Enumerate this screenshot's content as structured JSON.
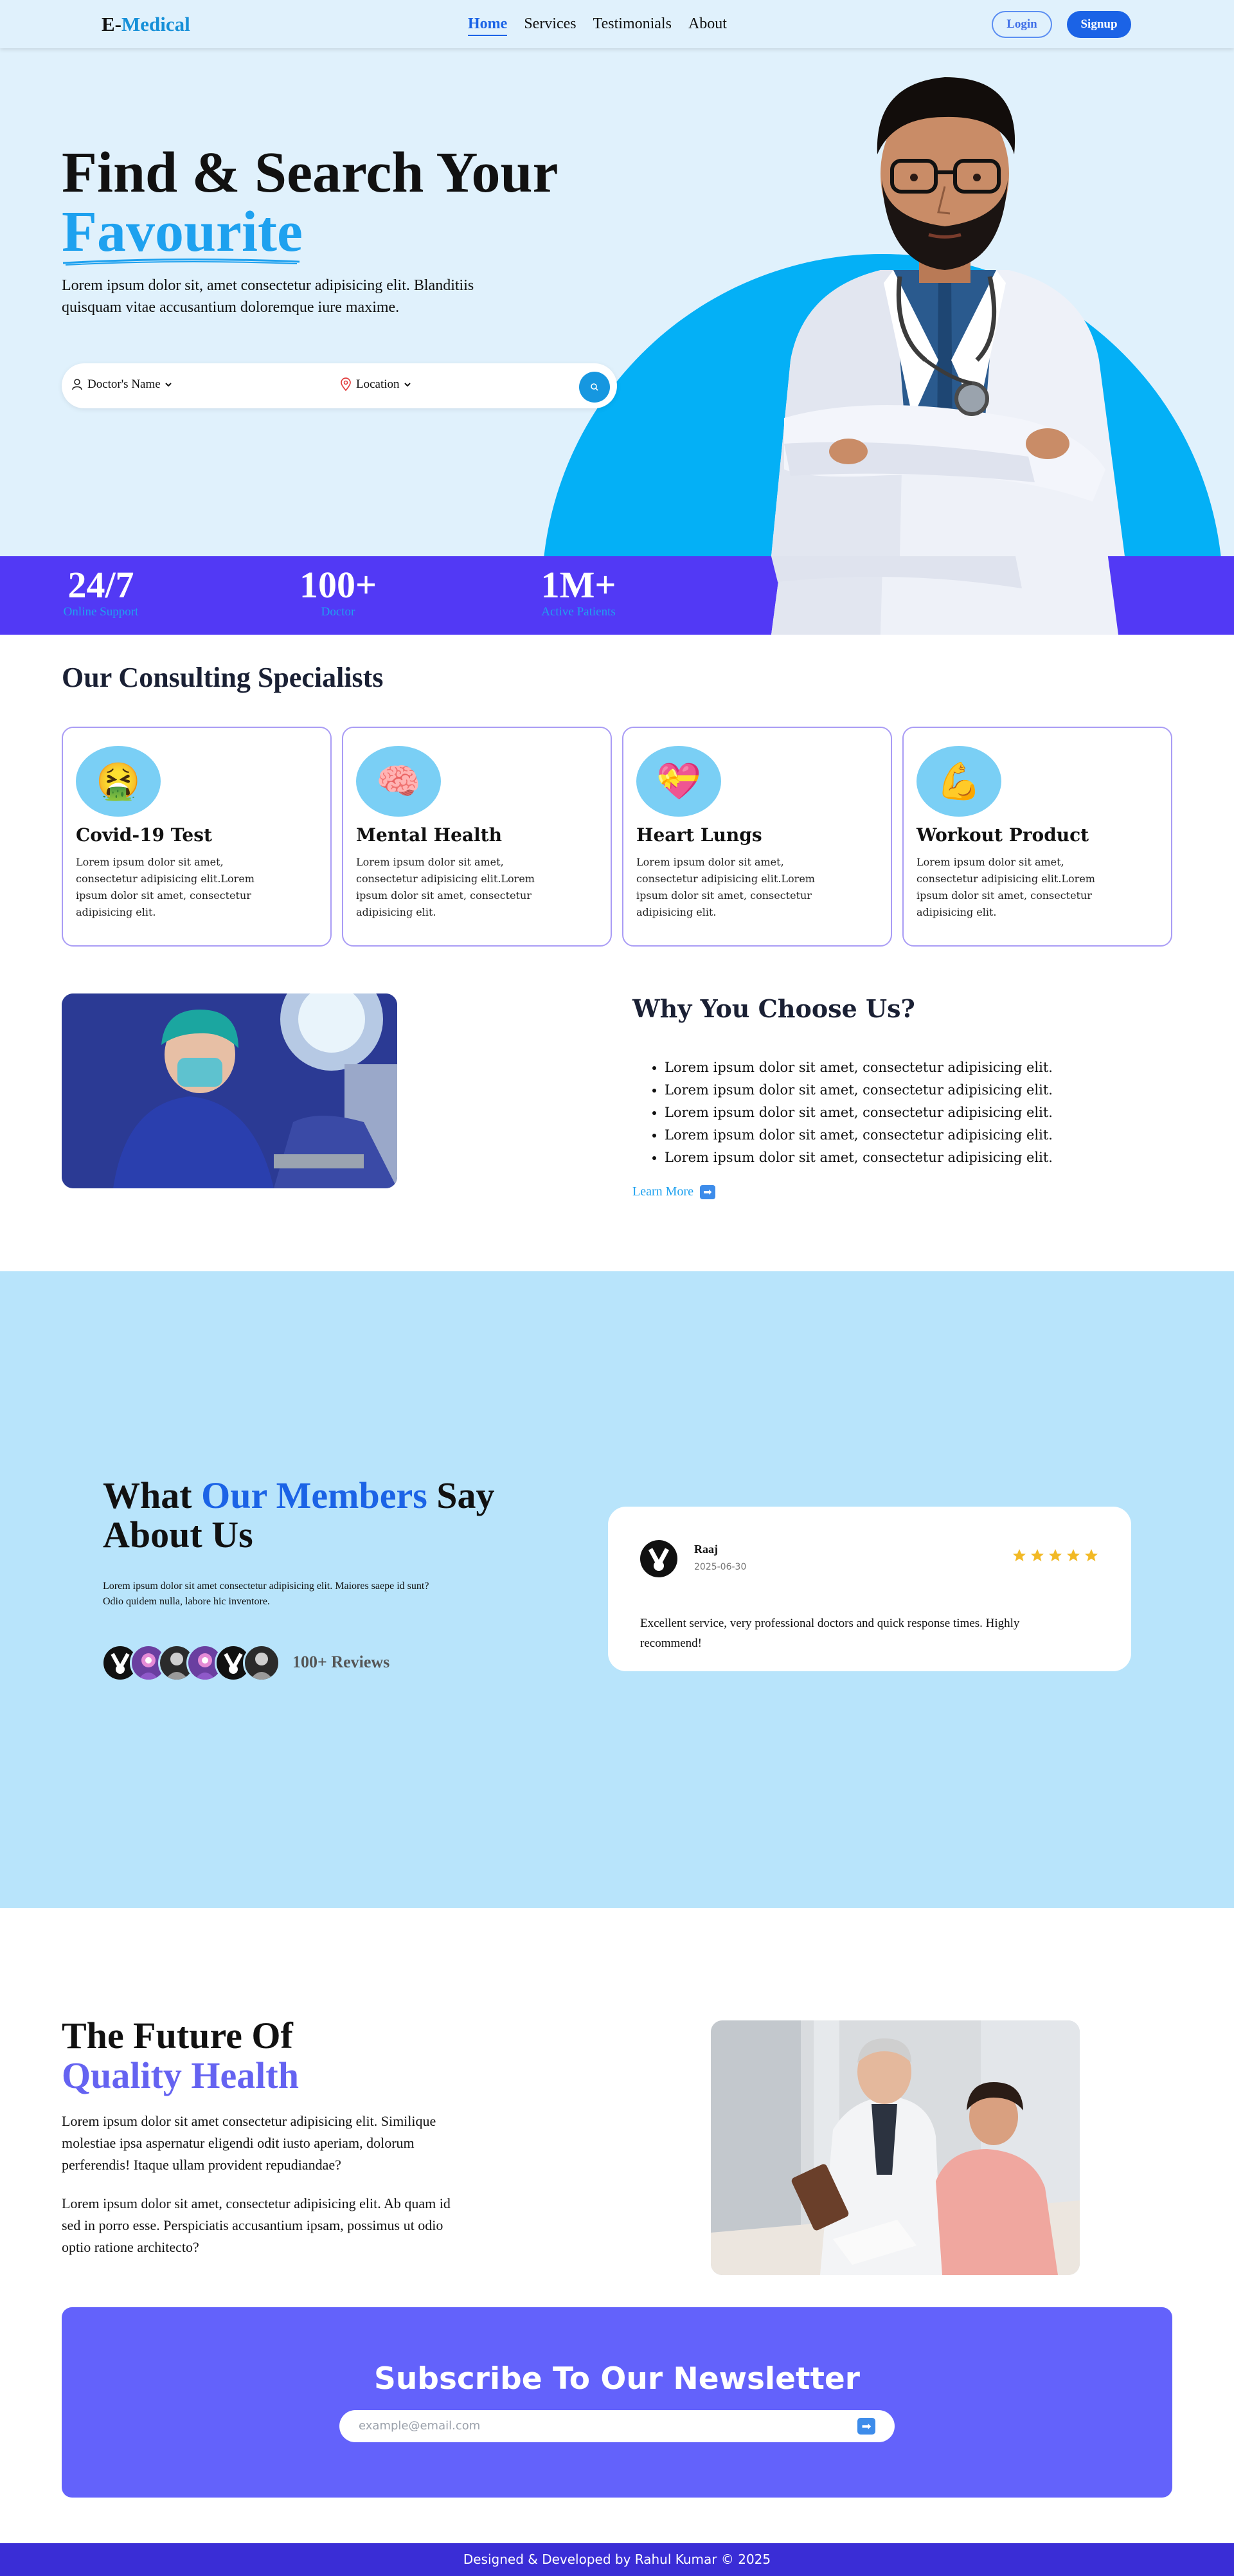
{
  "nav": {
    "brand_prefix": "E-",
    "brand_suffix": "Medical",
    "links": [
      {
        "label": "Home",
        "active": true
      },
      {
        "label": "Services"
      },
      {
        "label": "Testimonials"
      },
      {
        "label": "About"
      }
    ],
    "login_label": "Login",
    "signup_label": "Signup"
  },
  "hero": {
    "title_line1": "Find & Search Your",
    "title_line2": "Favourite",
    "description": "Lorem ipsum dolor sit, amet consectetur adipisicing elit. Blanditiis quisquam vitae accusantium doloremque iure maxime.",
    "search": {
      "doctor_label": "Doctor's Name",
      "location_label": "Location"
    }
  },
  "stats": [
    {
      "number": "24/7",
      "label": "Online Support"
    },
    {
      "number": "100+",
      "label": "Doctor"
    },
    {
      "number": "1M+",
      "label": "Active Patients"
    }
  ],
  "specialists": {
    "title": "Our Consulting Specialists",
    "cards": [
      {
        "icon": "sick-face-icon",
        "glyph": "🤮",
        "title": "Covid-19 Test",
        "text": "Lorem ipsum dolor sit amet, consectetur adipisicing elit.Lorem ipsum dolor sit amet, consectetur adipisicing elit."
      },
      {
        "icon": "brain-icon",
        "glyph": "🧠",
        "title": "Mental Health",
        "text": "Lorem ipsum dolor sit amet, consectetur adipisicing elit.Lorem ipsum dolor sit amet, consectetur adipisicing elit."
      },
      {
        "icon": "heart-icon",
        "glyph": "💝",
        "title": "Heart Lungs",
        "text": "Lorem ipsum dolor sit amet, consectetur adipisicing elit.Lorem ipsum dolor sit amet, consectetur adipisicing elit."
      },
      {
        "icon": "flexed-biceps-icon",
        "glyph": "💪",
        "title": "Workout Product",
        "text": "Lorem ipsum dolor sit amet, consectetur adipisicing elit.Lorem ipsum dolor sit amet, consectetur adipisicing elit."
      }
    ]
  },
  "why": {
    "title": "Why You Choose Us?",
    "items": [
      "Lorem ipsum dolor sit amet, consectetur adipisicing elit.",
      "Lorem ipsum dolor sit amet, consectetur adipisicing elit.",
      "Lorem ipsum dolor sit amet, consectetur adipisicing elit.",
      "Lorem ipsum dolor sit amet, consectetur adipisicing elit.",
      "Lorem ipsum dolor sit amet, consectetur adipisicing elit."
    ],
    "learn_more": "Learn More"
  },
  "testimonials": {
    "title_part1": "What",
    "title_highlight": "Our Members",
    "title_part2": "Say",
    "title_line2": "About Us",
    "description": "Lorem ipsum dolor sit amet consectetur adipisicing elit. Maiores saepe id sunt? Odio quidem nulla, labore hic inventore.",
    "reviews_count": "100+ Reviews",
    "review": {
      "name": "Raaj",
      "date": "2025-06-30",
      "rating": 5,
      "text": "Excellent service, very professional doctors and quick response times. Highly recommend!"
    }
  },
  "future": {
    "title_line1": "The Future Of",
    "title_line2": "Quality Health",
    "paragraph1": "Lorem ipsum dolor sit amet consectetur adipisicing elit. Similique molestiae ipsa aspernatur eligendi odit iusto aperiam, dolorum perferendis! Itaque ullam provident repudiandae?",
    "paragraph2": "Lorem ipsum dolor sit amet, consectetur adipisicing elit. Ab quam id sed in porro esse. Perspiciatis accusantium ipsam, possimus ut odio optio ratione architecto?"
  },
  "newsletter": {
    "title": "Subscribe To Our Newsletter",
    "placeholder": "example@email.com"
  },
  "footer": {
    "text": "Designed & Developed by Rahul Kumar © 2025"
  },
  "colors": {
    "accent_blue": "#1b63e6",
    "sky": "#1ea1ef",
    "purple": "#5239f5",
    "newsletter": "#6362fb"
  }
}
